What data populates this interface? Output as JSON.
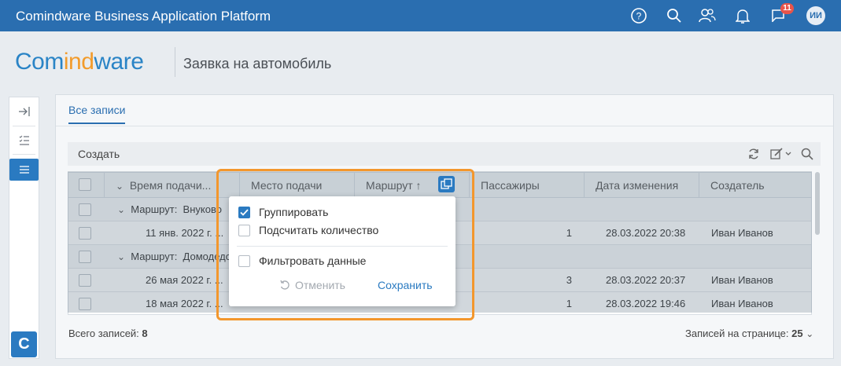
{
  "topbar": {
    "title": "Comindware Business Application Platform",
    "badge": "11",
    "avatar": "ИИ",
    "icons": [
      "help-icon",
      "search-icon",
      "users-icon",
      "bell-icon",
      "flag-icon"
    ]
  },
  "header": {
    "logo_a": "Com",
    "logo_b": "ind",
    "logo_c": "ware",
    "title": "Заявка на автомобиль"
  },
  "tabs": [
    {
      "label": "Все записи"
    }
  ],
  "toolbar": {
    "create": "Создать"
  },
  "grid": {
    "columns": [
      "Время подачи...",
      "Место подачи",
      "Маршрут ↑",
      "Пассажиры",
      "Дата изменения",
      "Создатель"
    ],
    "groups": [
      {
        "label": "Маршрут:",
        "value": "Внуково"
      },
      {
        "label": "Маршрут:",
        "value": "Домодедово"
      }
    ],
    "rows": [
      {
        "time": "11 янв. 2022 г. ...",
        "passengers": "1",
        "changed": "28.03.2022 20:38",
        "creator": "Иван Иванов"
      },
      {
        "time": "26 мая 2022 г. ...",
        "passengers": "3",
        "changed": "28.03.2022 20:37",
        "creator": "Иван Иванов"
      },
      {
        "time": "18 мая 2022 г. ...",
        "passengers": "1",
        "changed": "28.03.2022 19:46",
        "creator": "Иван Иванов"
      }
    ]
  },
  "footer": {
    "total_label": "Всего записей:",
    "total": "8",
    "per_page_label": "Записей на странице:",
    "per_page": "25"
  },
  "popup": {
    "group": "Группировать",
    "group_checked": true,
    "count": "Подсчитать количество",
    "filter": "Фильтровать данные",
    "cancel": "Отменить",
    "save": "Сохранить"
  },
  "colors": {
    "accent": "#2a7ac1",
    "topbar": "#2a6eb0",
    "highlight": "#f3972d",
    "badge": "#e8544a"
  }
}
